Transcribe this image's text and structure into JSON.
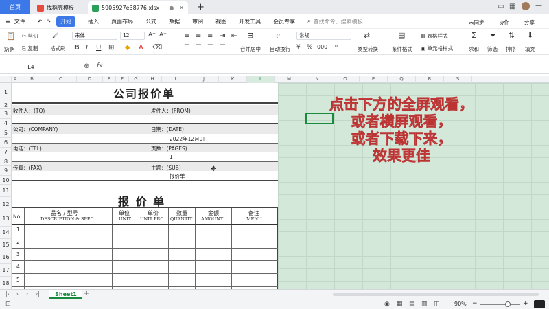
{
  "titlebar": {
    "home_tab": "首页",
    "tab1": "找稻壳模板",
    "tab2": "5905927e38776.xlsx",
    "new_tab": "+"
  },
  "menubar": {
    "file": "文件",
    "start": "开始",
    "items": [
      "插入",
      "页面布局",
      "公式",
      "数据",
      "审阅",
      "视图",
      "开发工具",
      "会员专享"
    ],
    "search_placeholder": "查找命令、搜索模板",
    "right": [
      "未同步",
      "协作",
      "分享"
    ]
  },
  "ribbon": {
    "paste": "粘贴",
    "cut": "剪切",
    "copy": "复制",
    "format_painter": "格式刷",
    "font": "宋体",
    "font_size": "12",
    "merge": "合并居中",
    "wrap": "自动换行",
    "number_format": "常规",
    "type_convert": "类型转换",
    "cond_format": "条件格式",
    "table_style": "表格样式",
    "cell_style": "单元格样式",
    "sum": "求和",
    "filter": "筛选",
    "sort": "排序",
    "fill": "填充",
    "percent": "%",
    "thousands": "000"
  },
  "formula_bar": {
    "cell_ref": "L4",
    "fx": "fx",
    "value": ""
  },
  "columns": [
    "A",
    "B",
    "C",
    "D",
    "E",
    "F",
    "G",
    "H",
    "I",
    "J",
    "K",
    "L",
    "M",
    "N",
    "O",
    "P",
    "Q",
    "R",
    "S"
  ],
  "rows": [
    "1",
    "2",
    "3",
    "4",
    "5",
    "6",
    "7",
    "8",
    "9",
    "10",
    "11",
    "12",
    "13",
    "14",
    "15",
    "16",
    "17",
    "18"
  ],
  "sheet": {
    "title": "公司报价单",
    "to_label": "收件人：(TO)",
    "from_label": "发件人：(FROM)",
    "company_label": "公司：(COMPANY)",
    "date_label": "日期：(DATE)",
    "date_value": "2022年12月9日",
    "tel_label": "电话：(TEL)",
    "pages_label": "页数：(PAGES)",
    "pages_value": "1",
    "fax_label": "传真：(FAX)",
    "sub_label": "主题：(SUB)",
    "sub_value": "报价单",
    "quote_title": "报 价 单",
    "table_headers": [
      {
        "cn": "No.",
        "en": ""
      },
      {
        "cn": "品名 / 型号",
        "en": "DESCRIPTION & SPEC"
      },
      {
        "cn": "单位",
        "en": "UNIT"
      },
      {
        "cn": "单价",
        "en": "UNIT PRC"
      },
      {
        "cn": "数量",
        "en": "QUANTIT"
      },
      {
        "cn": "金额",
        "en": "AMOUNT"
      },
      {
        "cn": "备注",
        "en": "MENU"
      }
    ],
    "row_numbers": [
      "1",
      "2",
      "3",
      "4",
      "5"
    ]
  },
  "overlay_text": [
    "点击下方的全屏观看，",
    "或者横屏观看，",
    "或者下载下来，",
    "效果更佳"
  ],
  "sheet_tab": "Sheet1",
  "status": {
    "zoom": "90%"
  },
  "colors": {
    "accent": "#3c78e8",
    "overlay": "#f07f86",
    "selection": "#1a8a3d",
    "green_area": "#d3e8d9"
  }
}
